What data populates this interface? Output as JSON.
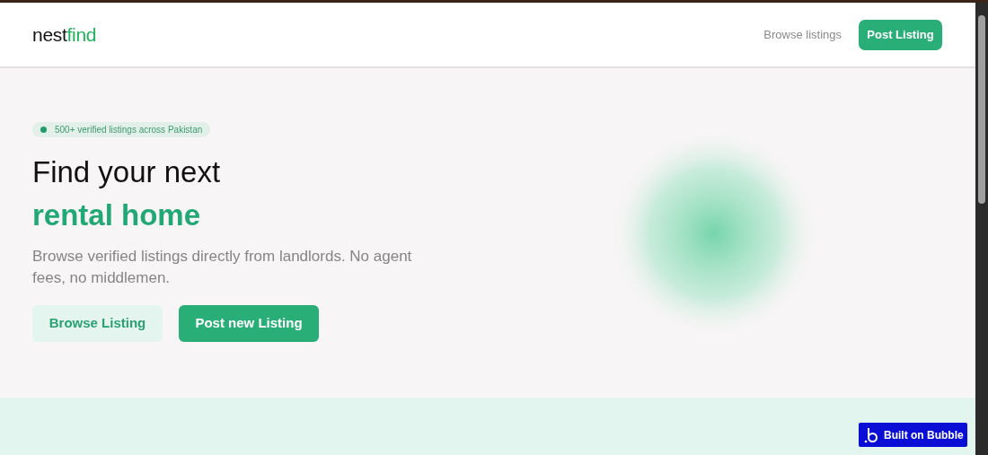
{
  "header": {
    "logo": {
      "part_1": "nest",
      "part_2": "find"
    },
    "nav_link": "Browse listings",
    "cta": "Post Listing"
  },
  "hero": {
    "badge": "500+ verified listings across Pakistan",
    "title_line_1": "Find your next",
    "title_line_2": "rental home",
    "subtitle": "Browse verified listings directly from landlords. No agent fees, no middlemen.",
    "buttons": [
      {
        "label": "Browse Listing",
        "kind": "secondary"
      },
      {
        "label": "Post new Listing",
        "kind": "primary"
      }
    ]
  },
  "bubble_badge": "Built on Bubble"
}
